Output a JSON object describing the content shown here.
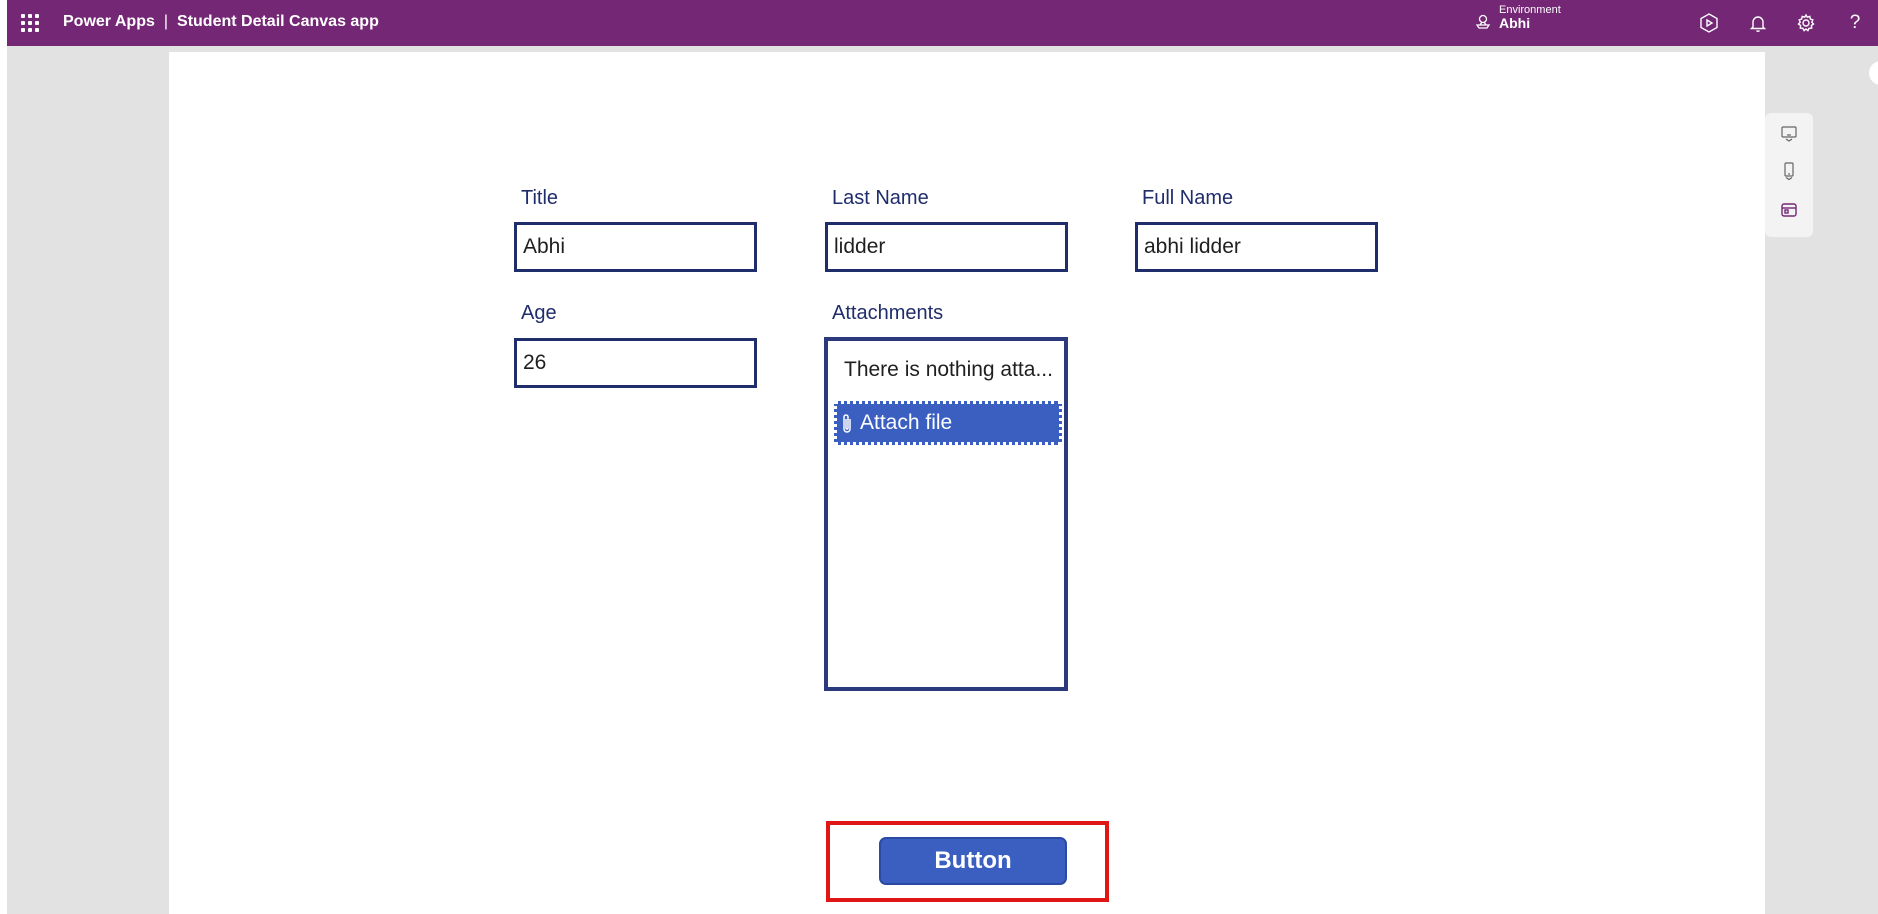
{
  "header": {
    "product": "Power Apps",
    "separator": "|",
    "app_name": "Student Detail Canvas app",
    "environment_label": "Environment",
    "environment_value": "Abhi",
    "bg_color": "#742774",
    "icons": [
      "waffle-icon",
      "environment-icon",
      "copilot-icon",
      "bell-icon",
      "gear-icon",
      "help-icon"
    ],
    "help_glyph": "?"
  },
  "form": {
    "title_label": "Title",
    "title_value": "Abhi",
    "lastname_label": "Last Name",
    "lastname_value": "lidder",
    "fullname_label": "Full Name",
    "fullname_value": "abhi lidder",
    "age_label": "Age",
    "age_value": "26",
    "attachments_label": "Attachments",
    "attachments_empty": "There is nothing atta...",
    "attach_button": "Attach file"
  },
  "action": {
    "button_label": "Button"
  },
  "colors": {
    "label": "#1f2d6b",
    "border": "#1f2d6b",
    "button": "#3b5fc0",
    "highlight": "#e01515"
  }
}
